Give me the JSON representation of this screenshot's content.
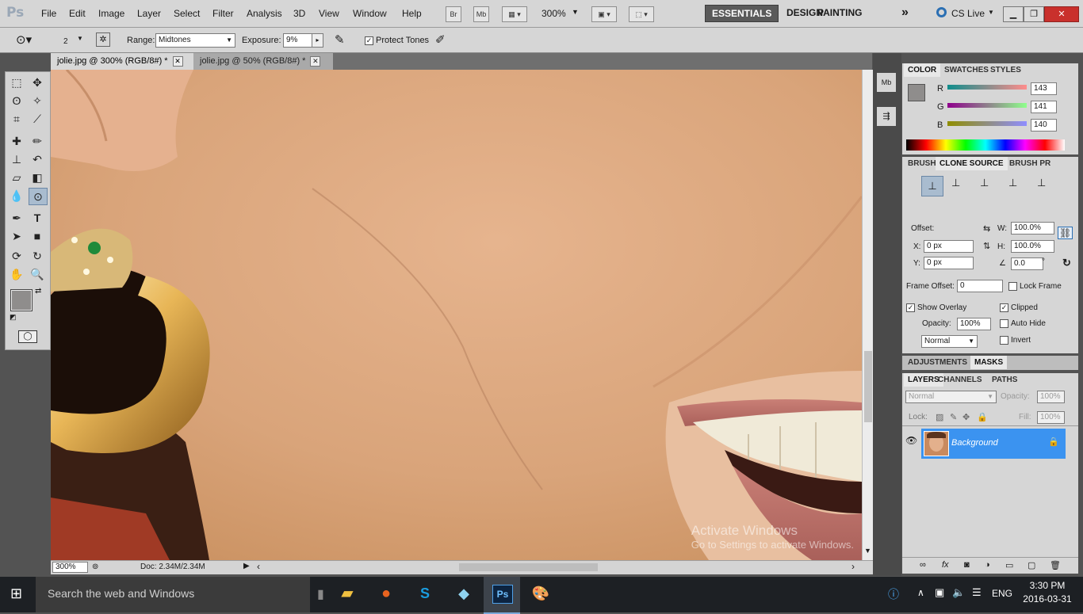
{
  "menubar": {
    "logo": "Ps",
    "menus": [
      "File",
      "Edit",
      "Image",
      "Layer",
      "Select",
      "Filter",
      "Analysis",
      "3D",
      "View",
      "Window",
      "Help"
    ],
    "bridge_label": "Br",
    "minibridge_label": "Mb",
    "zoom": "300%",
    "workspaces": [
      "ESSENTIALS",
      "DESIGN",
      "PAINTING"
    ],
    "more_label": "»",
    "cs_live": "CS Live"
  },
  "options": {
    "brush_size": "2",
    "range_label": "Range:",
    "range_value": "Midtones",
    "exposure_label": "Exposure:",
    "exposure_value": "9%",
    "protect_tones": "Protect Tones"
  },
  "tabs": [
    {
      "label": "jolie.jpg @ 300% (RGB/8#) *"
    },
    {
      "label": "jolie.jpg @ 50% (RGB/8#) *"
    }
  ],
  "status": {
    "zoom": "300%",
    "doc": "Doc: 2.34M/2.34M"
  },
  "color_panel": {
    "tabs": [
      "COLOR",
      "SWATCHES",
      "STYLES"
    ],
    "r_label": "R",
    "g_label": "G",
    "b_label": "B",
    "r": "143",
    "g": "141",
    "b": "140",
    "foreground": "#8f8d8c"
  },
  "clone_panel": {
    "tabs": [
      "BRUSH",
      "CLONE SOURCE",
      "BRUSH PR"
    ],
    "offset_label": "Offset:",
    "x_label": "X:",
    "x_value": "0 px",
    "y_label": "Y:",
    "y_value": "0 px",
    "w_label": "W:",
    "w_value": "100.0%",
    "h_label": "H:",
    "h_value": "100.0%",
    "angle_value": "0.0",
    "angle_unit": "°",
    "frame_offset_label": "Frame Offset:",
    "frame_offset_value": "0",
    "lock_frame": "Lock Frame",
    "show_overlay": "Show Overlay",
    "clipped": "Clipped",
    "opacity_label": "Opacity:",
    "opacity_value": "100%",
    "auto_hide": "Auto Hide",
    "invert": "Invert",
    "blend_mode": "Normal"
  },
  "adjust_panel": {
    "tabs": [
      "ADJUSTMENTS",
      "MASKS"
    ]
  },
  "layers_panel": {
    "tabs": [
      "LAYERS",
      "CHANNELS",
      "PATHS"
    ],
    "blend_mode": "Normal",
    "opacity_label": "Opacity:",
    "opacity_value": "100%",
    "lock_label": "Lock:",
    "fill_label": "Fill:",
    "fill_value": "100%",
    "layers": [
      {
        "name": "Background"
      }
    ]
  },
  "watermark": {
    "line1": "Activate Windows",
    "line2": "Go to Settings to activate Windows."
  },
  "taskbar": {
    "search_placeholder": "Search the web and Windows",
    "time": "3:30 PM",
    "date": "2016-03-31",
    "language": "ENG"
  },
  "colors": {
    "accent_selected_layer": "#3b93f0",
    "skin": "#d9a47a"
  }
}
